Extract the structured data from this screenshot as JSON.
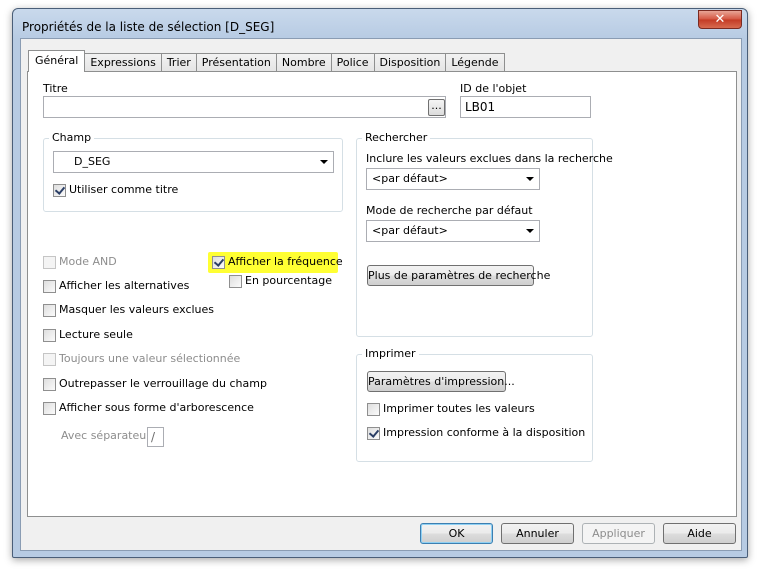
{
  "window": {
    "title": "Propriétés de la liste de sélection [D_SEG]",
    "close_label": "✕"
  },
  "tabs": [
    "Général",
    "Expressions",
    "Trier",
    "Présentation",
    "Nombre",
    "Police",
    "Disposition",
    "Légende"
  ],
  "active_tab": "Général",
  "titre": {
    "label": "Titre",
    "value": "",
    "browse_label": "..."
  },
  "object_id": {
    "label": "ID de l'objet",
    "value": "LB01"
  },
  "champ": {
    "group_label": "Champ",
    "selected": "D_SEG",
    "use_as_title_label": "Utiliser comme titre",
    "use_as_title_checked": true
  },
  "options": {
    "mode_and": {
      "label": "Mode AND",
      "checked": false,
      "enabled": false
    },
    "show_alternatives": {
      "label": "Afficher les alternatives",
      "checked": false
    },
    "hide_excluded": {
      "label": "Masquer les valeurs exclues",
      "checked": false
    },
    "read_only": {
      "label": "Lecture seule",
      "checked": false
    },
    "always_one_selected": {
      "label": "Toujours une valeur sélectionnée",
      "checked": false,
      "enabled": false
    },
    "override_lock": {
      "label": "Outrepasser le verrouillage du champ",
      "checked": false
    },
    "tree_view": {
      "label": "Afficher sous forme d'arborescence",
      "checked": false
    },
    "separator_label": "Avec séparateur",
    "separator_value": "/",
    "show_frequency": {
      "label": "Afficher la fréquence",
      "checked": true,
      "highlight_color": "#ffff33"
    },
    "in_percent": {
      "label": "En pourcentage",
      "checked": false
    }
  },
  "search": {
    "group_label": "Rechercher",
    "include_excluded_label": "Inclure les valeurs exclues dans la recherche",
    "include_excluded_value": "<par défaut>",
    "default_mode_label": "Mode de recherche par défaut",
    "default_mode_value": "<par défaut>",
    "more_params_button": "Plus de paramètres de recherche"
  },
  "print": {
    "group_label": "Imprimer",
    "params_button": "Paramètres d'impression...",
    "print_all_label": "Imprimer toutes les valeurs",
    "print_all_checked": false,
    "print_layout_label": "Impression conforme à la disposition",
    "print_layout_checked": true
  },
  "footer": {
    "ok": "OK",
    "cancel": "Annuler",
    "apply": "Appliquer",
    "help": "Aide"
  }
}
